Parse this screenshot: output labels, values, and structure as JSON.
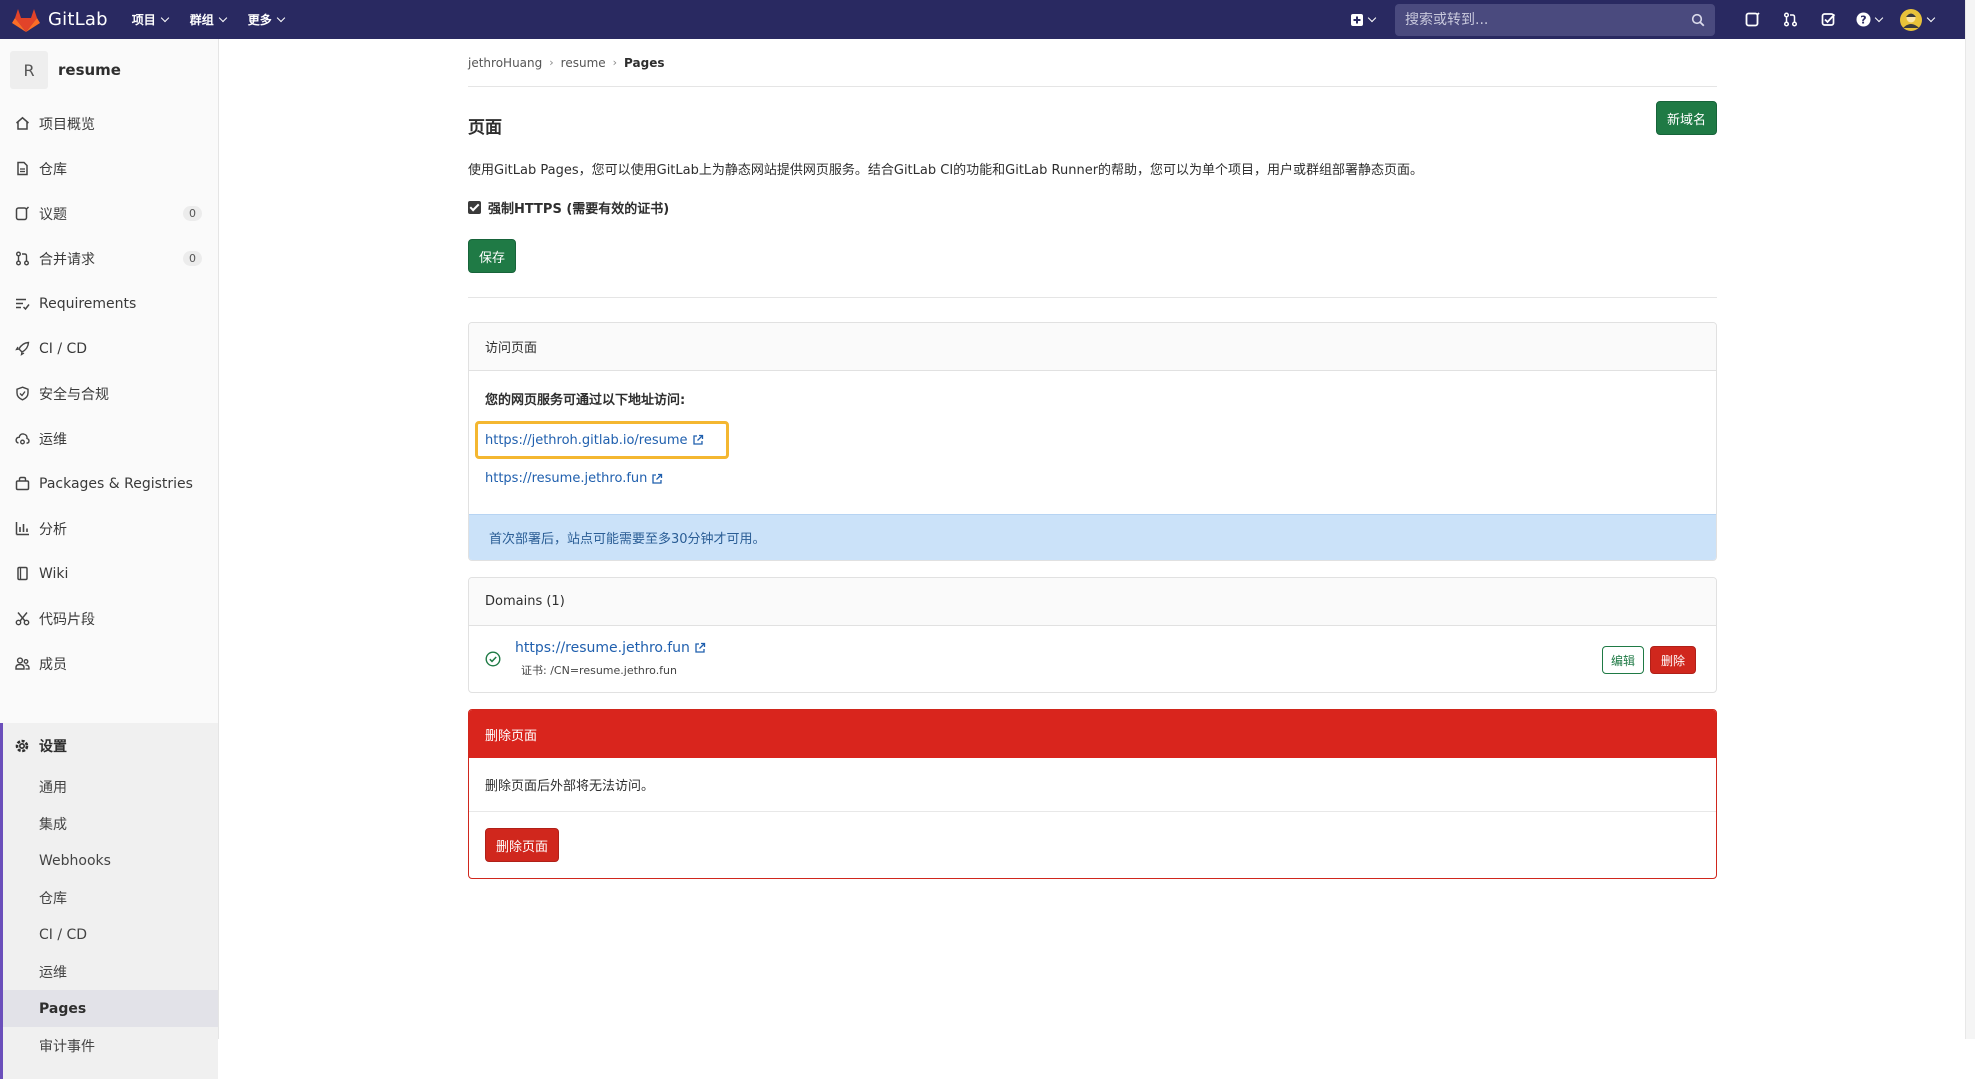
{
  "navbar": {
    "brand": "GitLab",
    "menu": [
      {
        "label": "项目"
      },
      {
        "label": "群组"
      },
      {
        "label": "更多"
      }
    ],
    "search_placeholder": "搜索或转到..."
  },
  "sidebar": {
    "project_initial": "R",
    "project_name": "resume",
    "items": [
      {
        "label": "项目概览"
      },
      {
        "label": "仓库"
      },
      {
        "label": "议题",
        "badge": "0"
      },
      {
        "label": "合并请求",
        "badge": "0"
      },
      {
        "label": "Requirements"
      },
      {
        "label": "CI / CD"
      },
      {
        "label": "安全与合规"
      },
      {
        "label": "运维"
      },
      {
        "label": "Packages & Registries"
      },
      {
        "label": "分析"
      },
      {
        "label": "Wiki"
      },
      {
        "label": "代码片段"
      },
      {
        "label": "成员"
      }
    ],
    "settings": {
      "label": "设置",
      "sub": [
        {
          "label": "通用"
        },
        {
          "label": "集成"
        },
        {
          "label": "Webhooks"
        },
        {
          "label": "仓库"
        },
        {
          "label": "CI / CD"
        },
        {
          "label": "运维"
        },
        {
          "label": "Pages",
          "active": true
        },
        {
          "label": "审计事件"
        }
      ]
    }
  },
  "breadcrumb": {
    "owner": "jethroHuang",
    "project": "resume",
    "current": "Pages"
  },
  "page": {
    "title": "页面",
    "new_domain_button": "新域名",
    "intro": "使用GitLab Pages，您可以使用GitLab上为静态网站提供网页服务。结合GitLab CI的功能和GitLab Runner的帮助，您可以为单个项目，用户或群组部署静态页面。",
    "force_https_label": "强制HTTPS (需要有效的证书)",
    "force_https_checked": true,
    "save_button": "保存"
  },
  "access": {
    "header": "访问页面",
    "label": "您的网页服务可通过以下地址访问:",
    "links": [
      "https://jethroh.gitlab.io/resume",
      "https://resume.jethro.fun"
    ],
    "notice": "首次部署后，站点可能需要至多30分钟才可用。"
  },
  "domains": {
    "header": "Domains (1)",
    "items": [
      {
        "url": "https://resume.jethro.fun",
        "cert": "证书: /CN=resume.jethro.fun",
        "edit": "编辑",
        "delete": "删除"
      }
    ]
  },
  "danger": {
    "header": "删除页面",
    "text": "删除页面后外部将无法访问。",
    "button": "删除页面"
  },
  "colors": {
    "navbar": "#292961",
    "green": "#1f7a45",
    "red": "#d0271d",
    "link": "#1f5fae",
    "highlight": "#f4b731"
  }
}
